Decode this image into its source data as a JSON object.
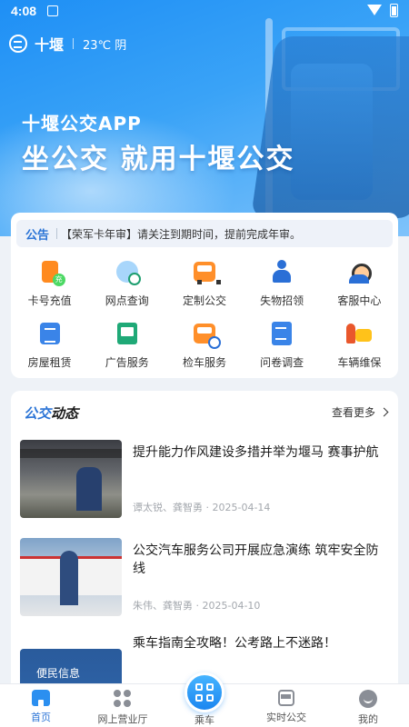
{
  "status_bar": {
    "time": "4:08"
  },
  "header": {
    "city": "十堰",
    "weather": "23℃ 阴"
  },
  "banner": {
    "line1": "十堰公交APP",
    "line2": "坐公交 就用十堰公交"
  },
  "notice": {
    "tag": "公告",
    "text": "【荣军卡年审】请关注到期时间，提前完成年审。"
  },
  "services": [
    {
      "label": "卡号充值",
      "icon": "card-recharge-icon"
    },
    {
      "label": "网点查询",
      "icon": "outlet-search-icon"
    },
    {
      "label": "定制公交",
      "icon": "custom-bus-icon"
    },
    {
      "label": "失物招领",
      "icon": "lost-found-icon"
    },
    {
      "label": "客服中心",
      "icon": "customer-service-icon"
    },
    {
      "label": "房屋租赁",
      "icon": "house-rental-icon"
    },
    {
      "label": "广告服务",
      "icon": "ad-service-icon"
    },
    {
      "label": "检车服务",
      "icon": "vehicle-inspection-icon"
    },
    {
      "label": "问卷调查",
      "icon": "survey-icon"
    },
    {
      "label": "车辆维保",
      "icon": "vehicle-maintenance-icon"
    }
  ],
  "news": {
    "title_a": "公交",
    "title_b": "动态",
    "more": "查看更多",
    "articles": [
      {
        "headline": "提升能力作风建设多措并举为堰马 赛事护航",
        "meta": "谭太锐、龚智勇 · 2025-04-14"
      },
      {
        "headline": "公交汽车服务公司开展应急演练 筑牢安全防线",
        "meta": "朱伟、龚智勇 · 2025-04-10"
      },
      {
        "headline": "乘车指南全攻略！公考路上不迷路！",
        "meta": "",
        "thumb_text": "便民信息"
      }
    ]
  },
  "bottom_nav": [
    {
      "label": "首页",
      "icon": "home-icon",
      "active": true
    },
    {
      "label": "网上营业厅",
      "icon": "online-hall-icon",
      "active": false
    },
    {
      "label": "乘车",
      "icon": "qr-code-icon",
      "active": false
    },
    {
      "label": "实时公交",
      "icon": "realtime-bus-icon",
      "active": false
    },
    {
      "label": "我的",
      "icon": "profile-icon",
      "active": false
    }
  ],
  "colors": {
    "primary": "#2b74d6",
    "accent": "#1b86f0",
    "background": "#eef2f7"
  }
}
